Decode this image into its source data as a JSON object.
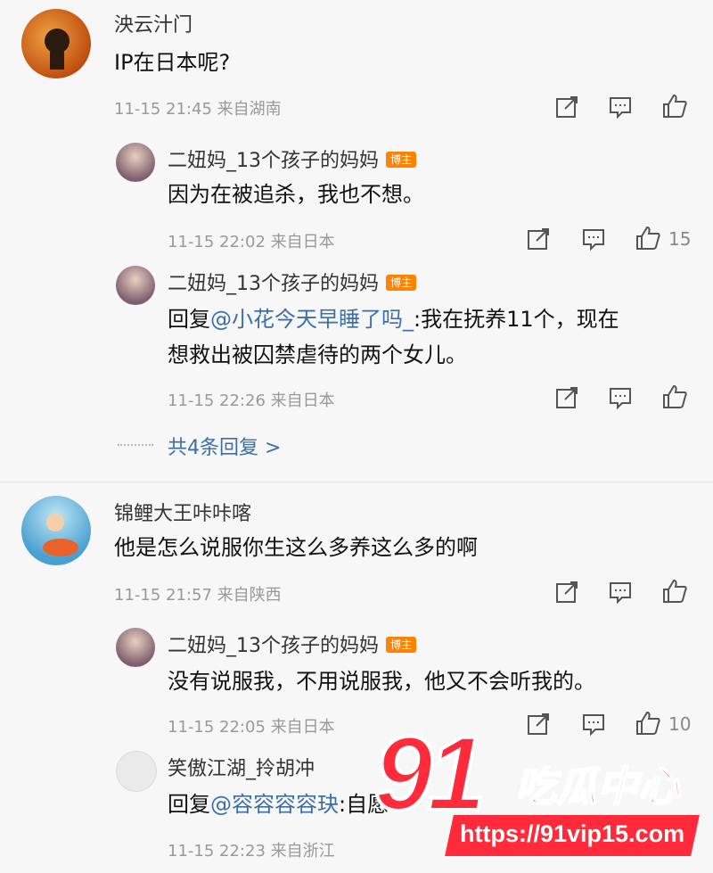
{
  "comments": [
    {
      "user": "泱云汁门",
      "text": "IP在日本呢?",
      "meta": "11-15 21:45 来自湖南",
      "replies": [
        {
          "user": "二妞妈_13个孩子的妈妈",
          "badge": "博主",
          "text": "因为在被追杀，我也不想。",
          "meta": "11-15 22:02 来自日本",
          "likes": "15"
        },
        {
          "user": "二妞妈_13个孩子的妈妈",
          "badge": "博主",
          "reply_prefix": "回复",
          "mention": "@小花今天早睡了吗_",
          "text_line1": ":我在抚养11个，现在",
          "text_line2": "想救出被囚禁虐待的两个女儿。",
          "meta": "11-15 22:26 来自日本"
        }
      ],
      "more_replies": "共4条回复 >"
    },
    {
      "user": "锦鲤大王咔咔喀",
      "text": "他是怎么说服你生这么多养这么多的啊",
      "meta": "11-15 21:57 来自陕西",
      "replies": [
        {
          "user": "二妞妈_13个孩子的妈妈",
          "badge": "博主",
          "text": "没有说服我，不用说服我，他又不会听我的。",
          "meta": "11-15 22:05 来自日本",
          "likes": "10"
        },
        {
          "user": "笑傲江湖_拎胡冲",
          "reply_prefix": "回复",
          "mention": "@容容容容玦",
          "text": ":自愿",
          "meta": "11-15 22:23 来自浙江"
        }
      ]
    }
  ],
  "watermark": {
    "number": "91",
    "brand": "吃瓜中心",
    "url": "https://91vip15.com"
  },
  "icons": [
    "share-icon",
    "comment-icon",
    "like-icon"
  ],
  "colors": {
    "mention": "#3c6fa8",
    "badge": "#ff8200",
    "watermark": "#ff2a3a"
  }
}
